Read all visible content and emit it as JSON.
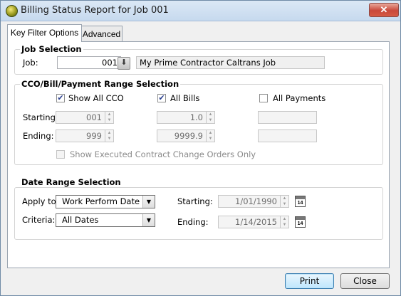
{
  "window": {
    "title": "Billing Status Report for Job 001",
    "close_glyph": "✕"
  },
  "tabs": [
    {
      "label": "Key Filter Options",
      "active": true
    },
    {
      "label": "Advanced",
      "active": false
    }
  ],
  "job_selection": {
    "title": "Job Selection",
    "job_label": "Job:",
    "job_value": "001",
    "job_name": "My Prime Contractor Caltrans Job",
    "lookup_icon": "down-arrow-lookup-icon"
  },
  "cco_range": {
    "title": "CCO/Bill/Payment Range Selection",
    "show_all_cco": {
      "label": "Show All CCO",
      "checked": true
    },
    "all_bills": {
      "label": "All Bills",
      "checked": true
    },
    "all_payments": {
      "label": "All Payments",
      "checked": false
    },
    "starting_label": "Starting:",
    "ending_label": "Ending:",
    "cco_start": "001",
    "cco_end": "999",
    "bill_start": "1.0",
    "bill_end": "9999.9",
    "payment_start": "",
    "payment_end": "",
    "executed_only": {
      "label": "Show Executed Contract Change Orders Only",
      "checked": false
    }
  },
  "date_range": {
    "title": "Date Range Selection",
    "apply_to_label": "Apply to:",
    "apply_to_value": "Work Perform Date",
    "criteria_label": "Criteria:",
    "criteria_value": "All Dates",
    "starting_label": "Starting:",
    "ending_label": "Ending:",
    "starting_date": "1/01/1990",
    "ending_date": "1/14/2015",
    "calendar_day": "14"
  },
  "footer": {
    "print_label": "Print",
    "close_label": "Close"
  }
}
